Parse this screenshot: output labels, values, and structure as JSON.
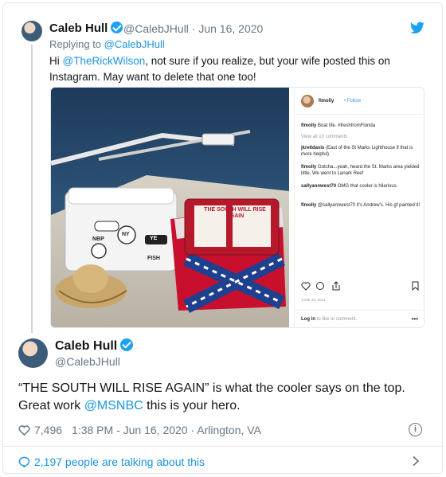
{
  "quoted_tweet": {
    "name": "Caleb Hull",
    "handle_date": "@CalebJHull · Jun 16, 2020",
    "replying_to_prefix": "Replying to ",
    "replying_to_handle": "@CalebJHull",
    "text_before": "Hi ",
    "mention": "@TheRickWilson",
    "text_after": ", not sure if you realize, but your wife posted this on Instagram. May want to delete that one too!"
  },
  "instagram_post": {
    "username": "flmolly",
    "follow_label": "• Follow",
    "caption_user": "flmolly",
    "caption_text": "Boat life. #freshfromFlorida",
    "view_all": "View all 10 comments",
    "comments": [
      {
        "user": "jkrelldavis",
        "text": "(East of the St Marks Lighthouse if that is more helpful)"
      },
      {
        "user": "flmolly",
        "text": "Gotcha...yeah, heard the St. Marks area yielded little. We went to Lanark Reef"
      },
      {
        "user": "sallyannwest70",
        "text": "OMG that cooler is hilarious."
      },
      {
        "user": "flmolly",
        "text": "@sallyannwest70 it's Andrew's. His gf painted it!"
      }
    ],
    "date": "JUNE 20, 2014",
    "login_bold": "Log in",
    "login_rest": " to like or comment."
  },
  "photo": {
    "cooler_text": "THE SOUTH WILL RISE AGAIN",
    "sticker_labels": [
      "NBP",
      "NY",
      "YE",
      "FISH"
    ]
  },
  "main_tweet": {
    "name": "Caleb Hull",
    "handle": "@CalebJHull",
    "text_before": "“THE SOUTH WILL RISE AGAIN” is what the cooler says on the top. Great work ",
    "mention": "@MSNBC",
    "text_after": " this is your hero.",
    "likes": "7,496",
    "timestamp": "1:38 PM - Jun 16, 2020 · Arlington, VA"
  },
  "footer": {
    "talking": "2,197 people are talking about this"
  },
  "colors": {
    "link": "#1b95e0",
    "verified": "#1da1f2",
    "muted": "#657786"
  },
  "icons": [
    "twitter-bird-icon",
    "verified-badge-icon",
    "heart-icon",
    "info-icon",
    "comment-bubble-icon",
    "chevron-right-icon"
  ]
}
